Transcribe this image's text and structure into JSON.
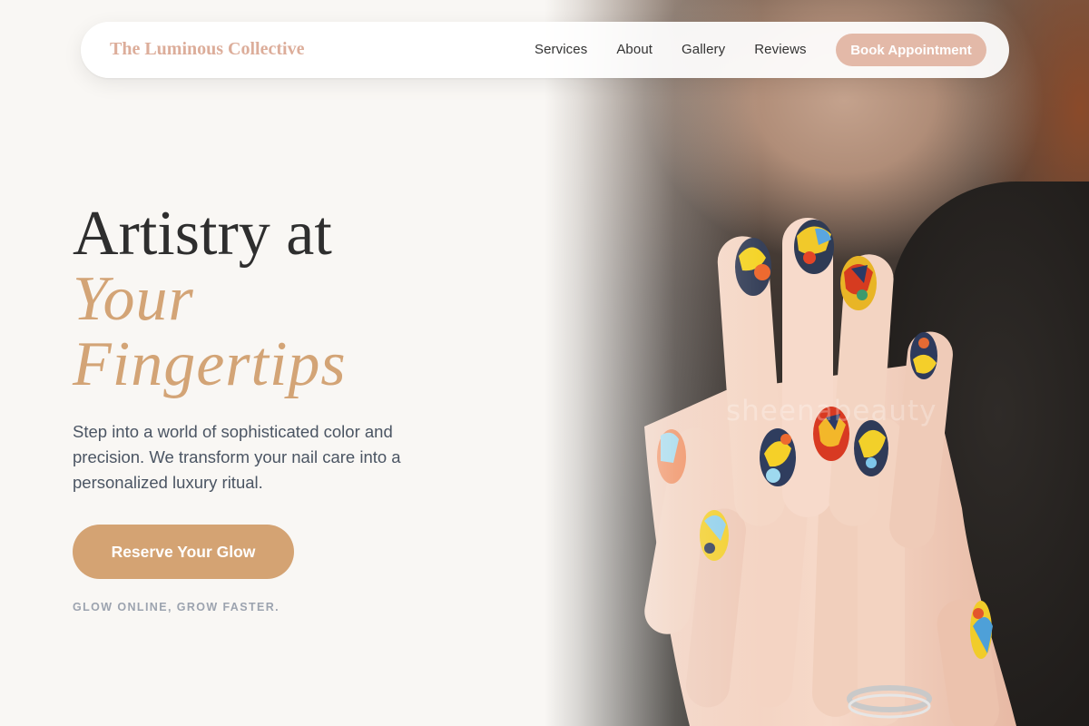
{
  "nav": {
    "brand": "The Luminous Collective",
    "links": [
      "Services",
      "About",
      "Gallery",
      "Reviews"
    ],
    "cta": "Book Appointment"
  },
  "hero": {
    "headline_line1": "Artistry at",
    "headline_accent_line1": "Your",
    "headline_accent_line2": "Fingertips",
    "intro": "Step into a world of sophisticated color and precision. We transform your nail care into a personalized luxury ritual.",
    "cta": "Reserve Your Glow",
    "tagline": "GLOW ONLINE, GROW FASTER.",
    "image_watermark": "sheenabeauty"
  },
  "colors": {
    "brand": "#dcad9a",
    "accent_gold": "#d4a373",
    "book_button": "#e3b9a8",
    "heading": "#2e2e2e",
    "body_text": "#4b5563",
    "muted": "#9ca3af",
    "background": "#f9f7f4"
  }
}
